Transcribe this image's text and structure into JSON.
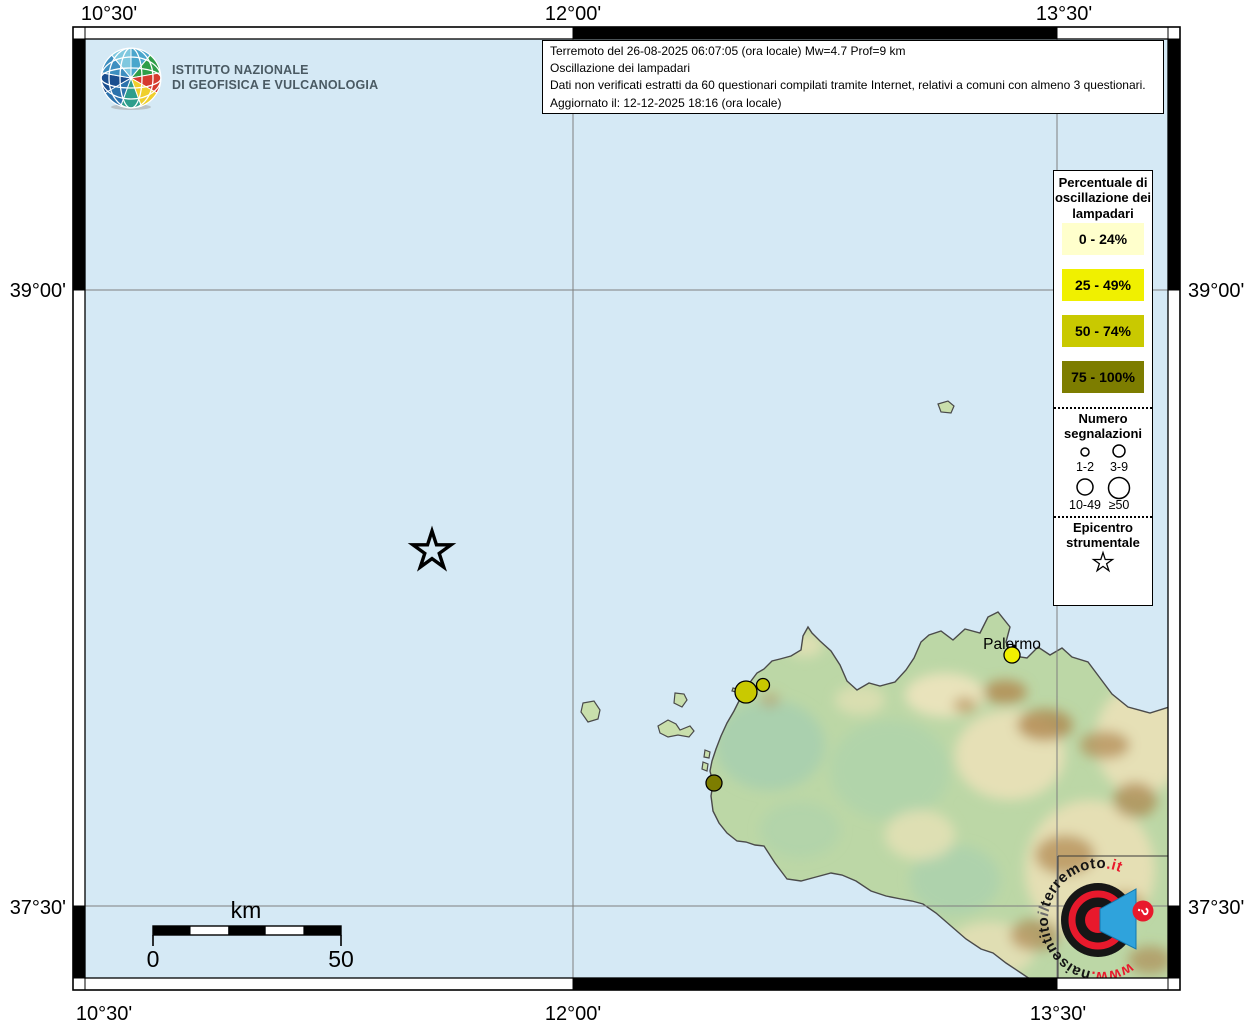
{
  "info_box": {
    "line1": "Terremoto del 26-08-2025 06:07:05 (ora locale) Mw=4.7 Prof=9 km",
    "line2": "Oscillazione dei lampadari",
    "line3": "Dati non verificati estratti da 60 questionari compilati tramite Internet, relativi a comuni con almeno 3 questionari.",
    "line4": "Aggiornato il: 12-12-2025 18:16 (ora locale)"
  },
  "branding": {
    "line1": "ISTITUTO NAZIONALE",
    "line2": "DI GEOFISICA E VULCANOLOGIA"
  },
  "axis": {
    "top": [
      "10°30'",
      "12°00'",
      "13°30'"
    ],
    "bottom": [
      "10°30'",
      "12°00'",
      "13°30'"
    ],
    "left": [
      "39°00'",
      "37°30'"
    ],
    "right": [
      "39°00'",
      "37°30'"
    ]
  },
  "legend": {
    "percent_title": "Percentuale di oscillazione dei lampadari",
    "classes": [
      {
        "label": "0 - 24%",
        "color": "#FFFFCC"
      },
      {
        "label": "25 - 49%",
        "color": "#F0F000"
      },
      {
        "label": "50 - 74%",
        "color": "#C9C900"
      },
      {
        "label": "75 - 100%",
        "color": "#7D7D00"
      }
    ],
    "count_title": "Numero segnalazioni",
    "counts": [
      "1-2",
      "3-9",
      "10-49",
      "≥50"
    ],
    "epicenter_title": "Epicentro strumentale"
  },
  "map": {
    "city": "Palermo"
  },
  "scalebar": {
    "unit": "km",
    "start": "0",
    "end": "50"
  },
  "watermark": {
    "www": "www.",
    "hai": "haisentito",
    "il": "il",
    "terremoto": "terremoto",
    "it": ".it"
  }
}
